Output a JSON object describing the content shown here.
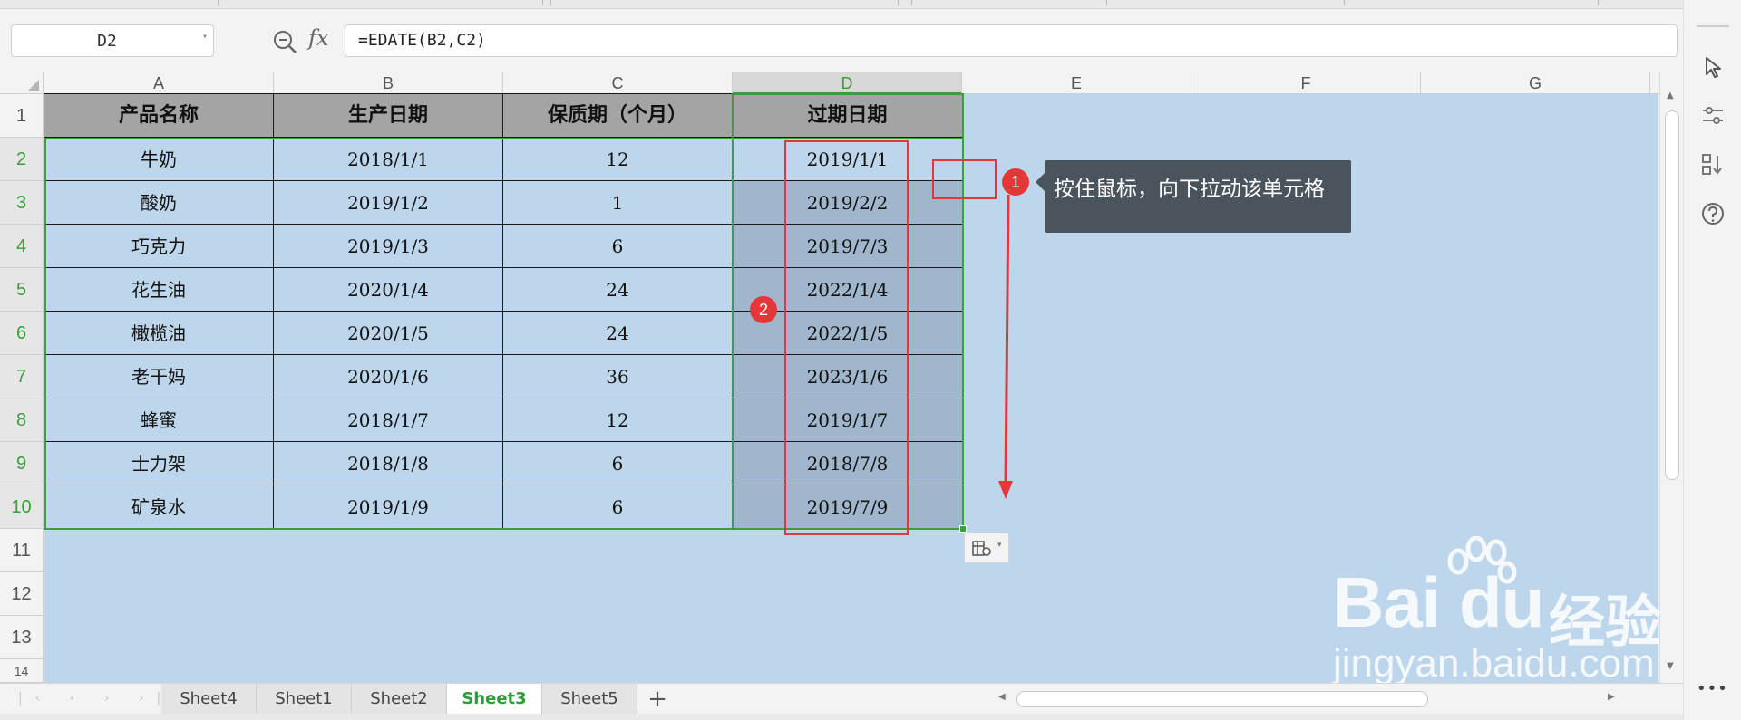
{
  "formula_bar": {
    "name_box": "D2",
    "formula": "=EDATE(B2,C2)",
    "fx_label": "fx"
  },
  "columns": [
    "A",
    "B",
    "C",
    "D",
    "E",
    "F",
    "G"
  ],
  "active_column": "D",
  "rows": [
    "1",
    "2",
    "3",
    "4",
    "5",
    "6",
    "7",
    "8",
    "9",
    "10",
    "11",
    "12",
    "13",
    "14"
  ],
  "table": {
    "headers": [
      "产品名称",
      "生产日期",
      "保质期（个月）",
      "过期日期"
    ],
    "rows": [
      [
        "牛奶",
        "2018/1/1",
        "12",
        "2019/1/1"
      ],
      [
        "酸奶",
        "2019/1/2",
        "1",
        "2019/2/2"
      ],
      [
        "巧克力",
        "2019/1/3",
        "6",
        "2019/7/3"
      ],
      [
        "花生油",
        "2020/1/4",
        "24",
        "2022/1/4"
      ],
      [
        "橄榄油",
        "2020/1/5",
        "24",
        "2022/1/5"
      ],
      [
        "老干妈",
        "2020/1/6",
        "36",
        "2023/1/6"
      ],
      [
        "蜂蜜",
        "2018/1/7",
        "12",
        "2019/1/7"
      ],
      [
        "士力架",
        "2018/1/8",
        "6",
        "2018/7/8"
      ],
      [
        "矿泉水",
        "2019/1/9",
        "6",
        "2019/7/9"
      ]
    ]
  },
  "annotations": {
    "step1_badge": "1",
    "step2_badge": "2",
    "tooltip": "按住鼠标，向下拉动该单元格"
  },
  "sheets": {
    "tabs": [
      "Sheet4",
      "Sheet1",
      "Sheet2",
      "Sheet3",
      "Sheet5"
    ],
    "active": "Sheet3",
    "add_label": "+"
  },
  "watermark": {
    "logo_text": "Bai du",
    "chinese": "经验",
    "url": "jingyan.baidu.com"
  },
  "colors": {
    "grid_background": "#bdd6ec",
    "header_fill": "#a4a4a4",
    "selection_green": "#3aa13a",
    "annotation_red": "#e43838",
    "tooltip_bg": "#4a545d"
  },
  "icons": {
    "zoom": "zoom-icon",
    "select_tool": "cursor-icon",
    "filter_tool": "slider-icon",
    "sort_tool": "sort-icon",
    "help": "help-icon",
    "more": "more-icon",
    "paste_options": "paste-options-icon"
  }
}
